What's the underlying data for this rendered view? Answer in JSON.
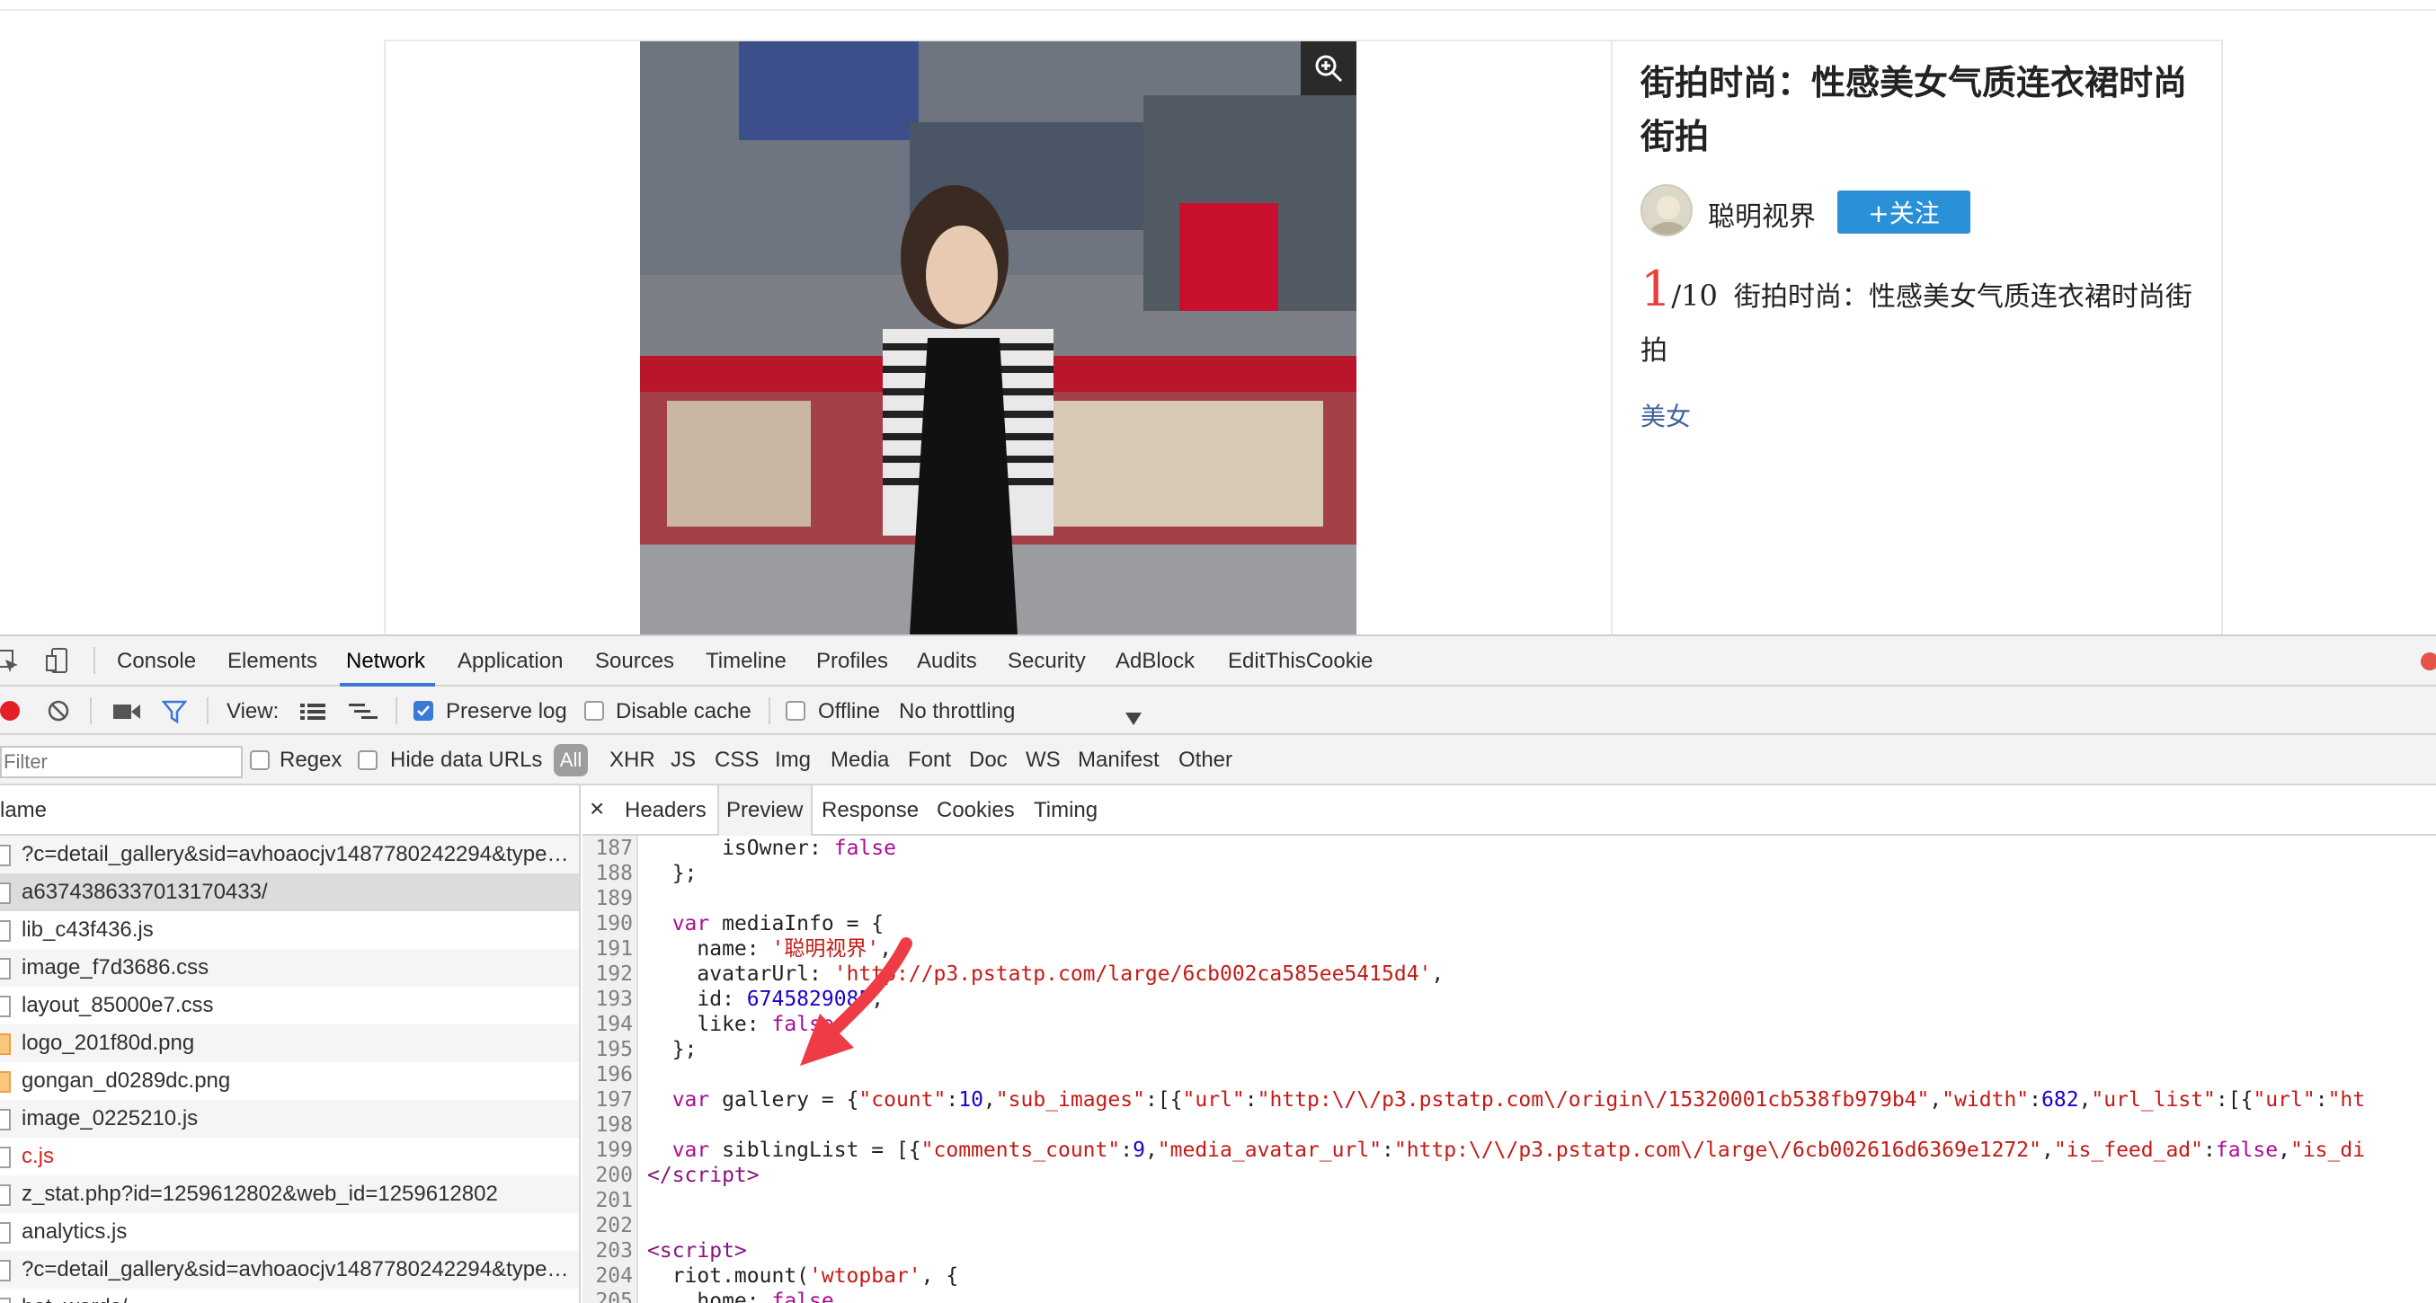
{
  "article": {
    "title": "街拍时尚：性感美女气质连衣裙时尚街拍",
    "author": "聪明视界",
    "follow_label": "+关注",
    "current_index": "1",
    "total": "/10",
    "caption": "街拍时尚：性感美女气质连衣裙时尚街拍",
    "tag": "美女",
    "zoom_icon": "zoom-in-icon"
  },
  "devtools": {
    "tabs": [
      "Console",
      "Elements",
      "Network",
      "Application",
      "Sources",
      "Timeline",
      "Profiles",
      "Audits",
      "Security",
      "AdBlock",
      "EditThisCookie"
    ],
    "toolbar": {
      "view_label": "View:",
      "preserve_log": "Preserve log",
      "disable_cache": "Disable cache",
      "offline": "Offline",
      "throttling": "No throttling"
    },
    "filter": {
      "placeholder": "Filter",
      "regex": "Regex",
      "hide_data_urls": "Hide data URLs",
      "all": "All",
      "types": [
        "XHR",
        "JS",
        "CSS",
        "Img",
        "Media",
        "Font",
        "Doc",
        "WS",
        "Manifest",
        "Other"
      ]
    },
    "list_header": "lame",
    "files": [
      {
        "name": "?c=detail_gallery&sid=avhoaocjv1487780242294&type…",
        "state": "alt"
      },
      {
        "name": "a6374386337013170433/",
        "state": "sel"
      },
      {
        "name": "lib_c43f436.js",
        "state": ""
      },
      {
        "name": "image_f7d3686.css",
        "state": "alt"
      },
      {
        "name": "layout_85000e7.css",
        "state": ""
      },
      {
        "name": "logo_201f80d.png",
        "state": "alt"
      },
      {
        "name": "gongan_d0289dc.png",
        "state": ""
      },
      {
        "name": "image_0225210.js",
        "state": "alt"
      },
      {
        "name": "c.js",
        "state": "err"
      },
      {
        "name": "z_stat.php?id=1259612802&web_id=1259612802",
        "state": "alt"
      },
      {
        "name": "analytics.js",
        "state": ""
      },
      {
        "name": "?c=detail_gallery&sid=avhoaocjv1487780242294&type…",
        "state": "alt"
      },
      {
        "name": "hot_words/",
        "state": ""
      }
    ],
    "subtabs": [
      "Headers",
      "Preview",
      "Response",
      "Cookies",
      "Timing"
    ],
    "close_label": "×",
    "code_lines": [
      {
        "n": "187",
        "html": "      isOwner: <span class=\"k\">false</span>"
      },
      {
        "n": "188",
        "html": "  };"
      },
      {
        "n": "189",
        "html": ""
      },
      {
        "n": "190",
        "html": "  <span class=\"k\">var</span> mediaInfo = {"
      },
      {
        "n": "191",
        "html": "    name: <span class=\"s\">'聪明视界'</span>,"
      },
      {
        "n": "192",
        "html": "    avatarUrl: <span class=\"s\">'http://p3.pstatp.com/large/6cb002ca585ee5415d4'</span>,"
      },
      {
        "n": "193",
        "html": "    id: <span class=\"n\">6745829085</span>,"
      },
      {
        "n": "194",
        "html": "    like: <span class=\"k\">false</span>"
      },
      {
        "n": "195",
        "html": "  };"
      },
      {
        "n": "196",
        "html": ""
      },
      {
        "n": "197",
        "html": "  <span class=\"k\">var</span> gallery = {<span class=\"s\">\"count\"</span>:<span class=\"n\">10</span>,<span class=\"s\">\"sub_images\"</span>:[{<span class=\"s\">\"url\"</span>:<span class=\"s\">\"http:\\/\\/p3.pstatp.com\\/origin\\/15320001cb538fb979b4\"</span>,<span class=\"s\">\"width\"</span>:<span class=\"n\">682</span>,<span class=\"s\">\"url_list\"</span>:[{<span class=\"s\">\"url\"</span>:<span class=\"s\">\"ht</span>"
      },
      {
        "n": "198",
        "html": ""
      },
      {
        "n": "199",
        "html": "  <span class=\"k\">var</span> siblingList = [{<span class=\"s\">\"comments_count\"</span>:<span class=\"n\">9</span>,<span class=\"s\">\"media_avatar_url\"</span>:<span class=\"s\">\"http:\\/\\/p3.pstatp.com\\/large\\/6cb002616d6369e1272\"</span>,<span class=\"s\">\"is_feed_ad\"</span>:<span class=\"k\">false</span>,<span class=\"s\">\"is_di</span>"
      },
      {
        "n": "200",
        "html": "<span class=\"t\">&lt;/script&gt;</span>"
      },
      {
        "n": "201",
        "html": ""
      },
      {
        "n": "202",
        "html": ""
      },
      {
        "n": "203",
        "html": "<span class=\"t\">&lt;script&gt;</span>"
      },
      {
        "n": "204",
        "html": "  riot.mount(<span class=\"s\">'wtopbar'</span>, {"
      },
      {
        "n": "205",
        "html": "    home: <span class=\"k\">false</span>,"
      }
    ]
  },
  "colors": {
    "accent": "#3879d9",
    "follow_button": "#2a90d7",
    "index_red": "#e8403c",
    "arrow": "#ee3b45"
  }
}
